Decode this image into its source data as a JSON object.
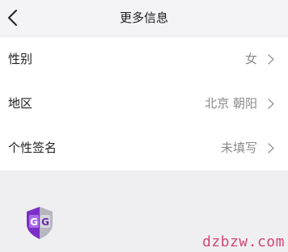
{
  "header": {
    "title": "更多信息",
    "back_icon": "chevron-left-icon"
  },
  "rows": [
    {
      "label": "性别",
      "value": "女"
    },
    {
      "label": "地区",
      "value": "北京 朝阳"
    },
    {
      "label": "个性签名",
      "value": "未填写"
    }
  ],
  "row_icon": "chevron-right-icon",
  "logo": {
    "letters": "GG",
    "icon": "game-guardian-logo-icon",
    "colors": {
      "purple": "#7b2fc7",
      "violet": "#a86bea",
      "grey": "#b6b6bf"
    }
  },
  "watermark": {
    "text": "dzbzw.com",
    "color": "#d54679"
  }
}
